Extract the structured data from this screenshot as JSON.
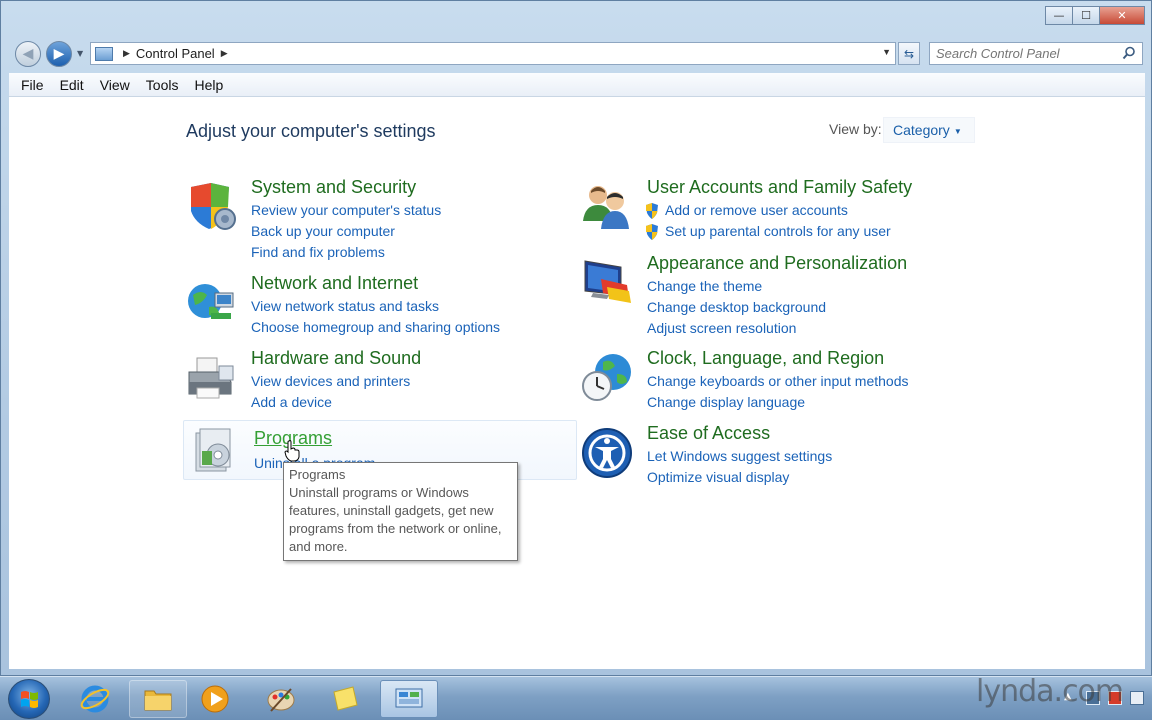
{
  "window": {
    "controls": {
      "minimize": "—",
      "maximize": "☐",
      "close": "✕"
    }
  },
  "nav": {
    "back_icon": "◀",
    "forward_icon": "▶",
    "breadcrumb": [
      "Control Panel"
    ],
    "search_placeholder": "Search Control Panel"
  },
  "menu": [
    "File",
    "Edit",
    "View",
    "Tools",
    "Help"
  ],
  "page": {
    "title": "Adjust your computer's settings",
    "view_by_label": "View by:",
    "view_by_value": "Category"
  },
  "categories": {
    "system": {
      "title": "System and Security",
      "icon": "shield-icon",
      "links": [
        "Review your computer's status",
        "Back up your computer",
        "Find and fix problems"
      ]
    },
    "network": {
      "title": "Network and Internet",
      "icon": "globe-network-icon",
      "links": [
        "View network status and tasks",
        "Choose homegroup and sharing options"
      ]
    },
    "hardware": {
      "title": "Hardware and Sound",
      "icon": "printer-icon",
      "links": [
        "View devices and printers",
        "Add a device"
      ]
    },
    "programs": {
      "title": "Programs",
      "icon": "programs-icon",
      "links": [
        "Uninstall a program"
      ]
    },
    "users": {
      "title": "User Accounts and Family Safety",
      "icon": "users-icon",
      "links": [
        "Add or remove user accounts",
        "Set up parental controls for any user"
      ]
    },
    "appearance": {
      "title": "Appearance and Personalization",
      "icon": "monitor-paint-icon",
      "links": [
        "Change the theme",
        "Change desktop background",
        "Adjust screen resolution"
      ]
    },
    "clock": {
      "title": "Clock, Language, and Region",
      "icon": "clock-globe-icon",
      "links": [
        "Change keyboards or other input methods",
        "Change display language"
      ]
    },
    "ease": {
      "title": "Ease of Access",
      "icon": "ease-of-access-icon",
      "links": [
        "Let Windows suggest settings",
        "Optimize visual display"
      ]
    }
  },
  "tooltip": {
    "title": "Programs",
    "lines": [
      "Uninstall programs or Windows",
      "features, uninstall gadgets, get new",
      "programs from the network or online,",
      "and more."
    ]
  },
  "taskbar": {
    "watermark": "lynda.com",
    "items": [
      "start-orb",
      "internet-explorer-icon",
      "file-explorer-icon",
      "media-player-icon",
      "paint-icon",
      "sticky-notes-icon",
      "control-panel-icon"
    ]
  },
  "colors": {
    "category_title": "#1f6c1f",
    "link": "#1b63b8",
    "page_title": "#1e3a5f"
  }
}
